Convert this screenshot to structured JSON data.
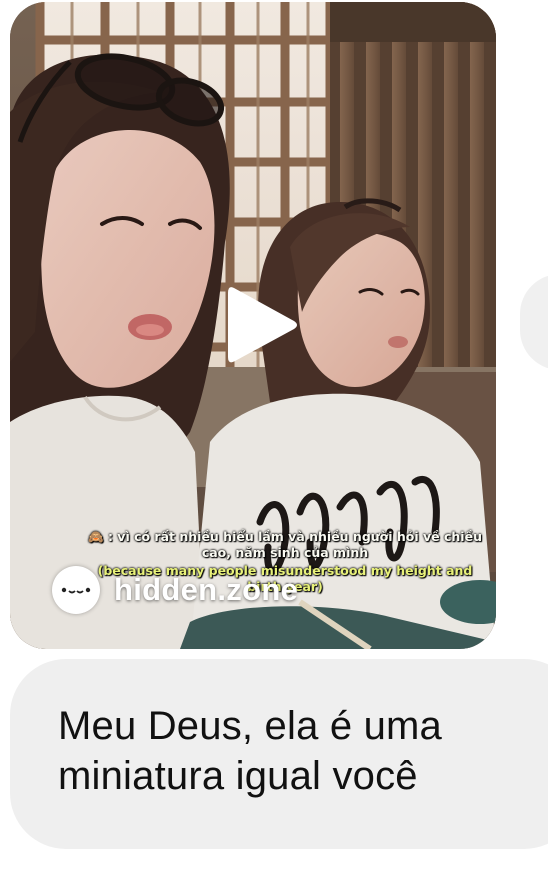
{
  "video_message": {
    "subtitle_vietnamese": "🙈 : vì có rất nhiều hiểu lầm và nhiều người hỏi về chiều cao, năm sinh của mình",
    "subtitle_english": "(because many people misunderstood my height and birth year)",
    "watermark_text": "hidden.zone",
    "play_icon": "play-icon",
    "watermark_icon": "face-icon"
  },
  "message": {
    "text": "Meu Deus, ela é uma\nminiatura igual você"
  },
  "colors": {
    "message_bubble": "#efefef",
    "side_bubble": "#f0f0f0",
    "subtitle_english": "#e9f27a"
  }
}
